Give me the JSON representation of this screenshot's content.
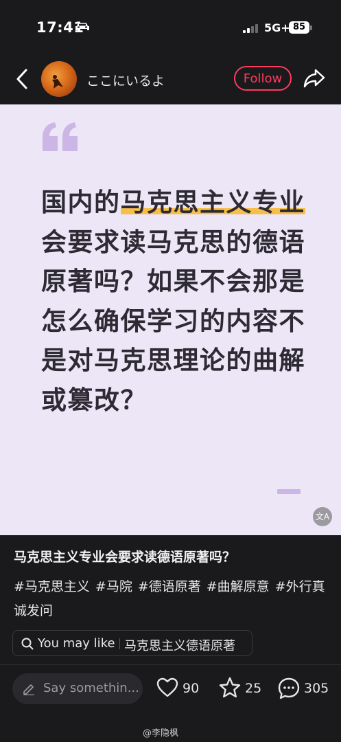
{
  "status_bar": {
    "time": "17:41",
    "network": "5G+",
    "battery": "85"
  },
  "header": {
    "username": "ここにいるよ",
    "follow_label": "Follow"
  },
  "post_card": {
    "question_parts": {
      "before": "国内的",
      "highlight": "马克思主义专业",
      "after": "会要求读马克思的德语原著吗？如果不会那是怎么确保学习的内容不是对马克思理论的曲解或篡改？"
    },
    "translate_label": "文A"
  },
  "post": {
    "title": "马克思主义专业会要求读德语原著吗？",
    "tags": [
      "#马克思主义",
      "#马院",
      "#德语原著",
      "#曲解原意",
      "#外行真诚发问"
    ]
  },
  "you_may_like": {
    "label": "You may like",
    "query": "马克思主义德语原著"
  },
  "action_bar": {
    "comment_placeholder": "Say somethin...",
    "likes": "90",
    "stars": "25",
    "comments": "305"
  },
  "watermark": "@李隐枫",
  "colors": {
    "accent": "#ff3b5c",
    "card_bg": "#ece6f7",
    "highlight": "#f7bf4a",
    "quote_mark": "#cbb6e6"
  }
}
